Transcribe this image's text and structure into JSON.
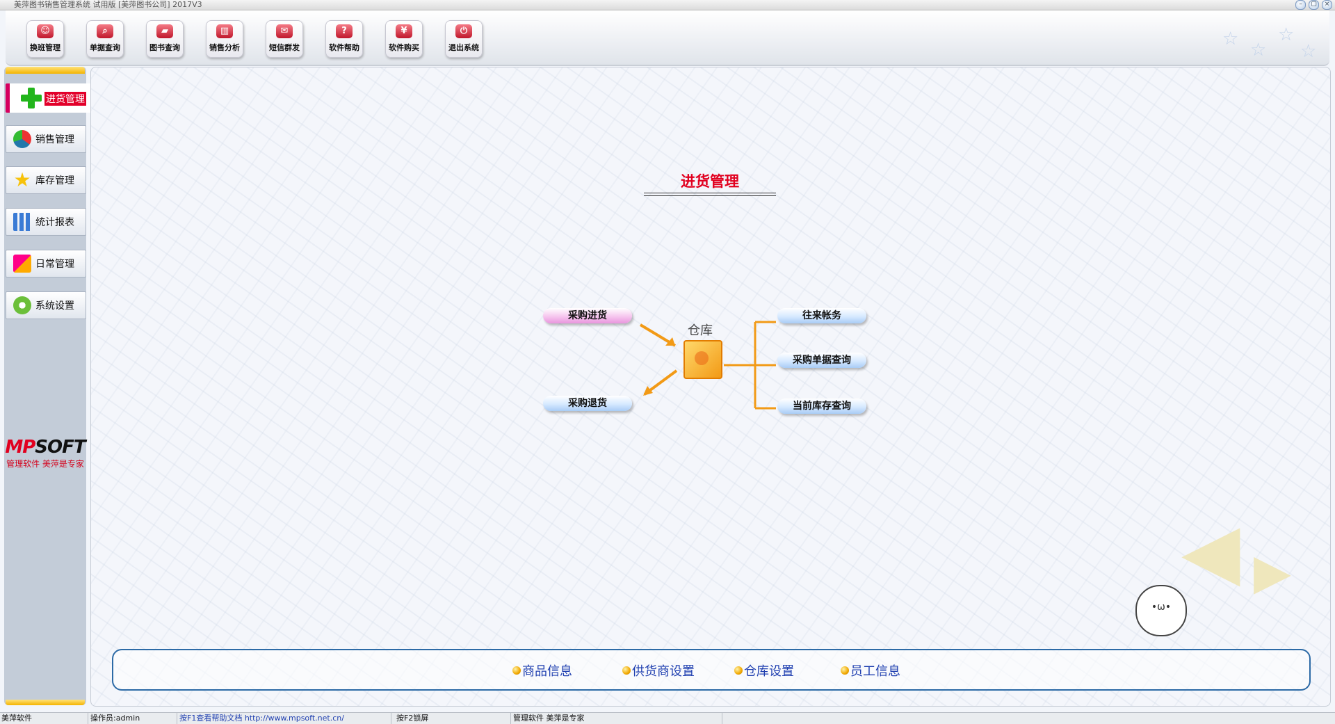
{
  "window": {
    "title": "美萍图书销售管理系统 试用版 [美萍图书公司] 2017V3"
  },
  "toolbar": {
    "buttons": [
      {
        "label": "换班管理",
        "icon": "user-icon"
      },
      {
        "label": "单据查询",
        "icon": "search-icon"
      },
      {
        "label": "图书查询",
        "icon": "book-icon"
      },
      {
        "label": "销售分析",
        "icon": "bar-chart-icon"
      },
      {
        "label": "短信群发",
        "icon": "mail-icon"
      },
      {
        "label": "软件帮助",
        "icon": "help-icon"
      },
      {
        "label": "软件购买",
        "icon": "yen-icon"
      },
      {
        "label": "退出系统",
        "icon": "power-icon"
      }
    ]
  },
  "sidebar": {
    "active": {
      "label": "进货管理",
      "icon": "plus-icon"
    },
    "items": [
      {
        "label": "销售管理",
        "icon": "pie-icon"
      },
      {
        "label": "库存管理",
        "icon": "star-icon"
      },
      {
        "label": "统计报表",
        "icon": "report-icon"
      },
      {
        "label": "日常管理",
        "icon": "calendar-icon"
      },
      {
        "label": "系统设置",
        "icon": "gear-icon"
      }
    ],
    "brand": {
      "logo_main": "MP",
      "logo_rest": "SOFT",
      "slogan": "管理软件 美萍是专家"
    }
  },
  "main": {
    "title": "进货管理",
    "flow": {
      "purchase_in": "采购进货",
      "purchase_return": "采购退货",
      "warehouse": "仓库",
      "accounts": "往来帐务",
      "purchase_order_query": "采购单据查询",
      "stock_query": "当前库存查询"
    },
    "quick_links": [
      "商品信息",
      "供货商设置",
      "仓库设置",
      "员工信息"
    ]
  },
  "statusbar": {
    "company": "美萍软件",
    "operator": "操作员:admin",
    "help": "按F1查看帮助文档",
    "url": "http://www.mpsoft.net.cn/",
    "lock": "按F2锁屏",
    "slogan": "管理软件 美萍是专家"
  },
  "colors": {
    "accent_red": "#e1001f",
    "link_blue": "#1f3fb0",
    "flow_orange": "#f29a16"
  }
}
